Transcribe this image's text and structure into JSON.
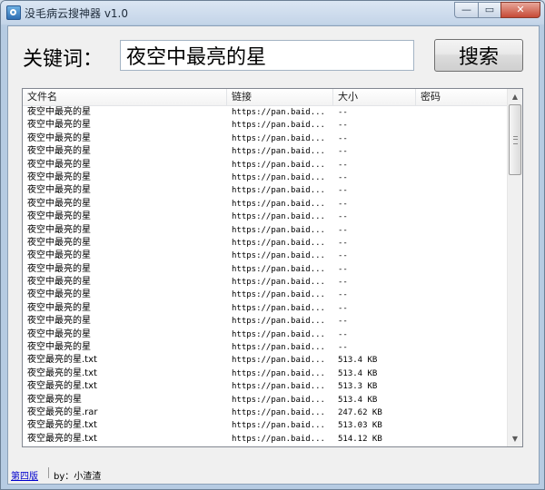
{
  "window": {
    "title": "没毛病云搜神器 v1.0",
    "minimize_glyph": "—",
    "maximize_glyph": "▭",
    "close_glyph": "✕"
  },
  "search": {
    "label": "关键词：",
    "value": "夜空中最亮的星",
    "button_label": "搜索"
  },
  "list": {
    "columns": [
      "文件名",
      "链接",
      "大小",
      "密码"
    ],
    "rows": [
      [
        "夜空中最亮的星",
        "https://pan.baid...",
        "--",
        ""
      ],
      [
        "夜空中最亮的星",
        "https://pan.baid...",
        "--",
        ""
      ],
      [
        "夜空中最亮的星",
        "https://pan.baid...",
        "--",
        ""
      ],
      [
        "夜空中最亮的星",
        "https://pan.baid...",
        "--",
        ""
      ],
      [
        "夜空中最亮的星",
        "https://pan.baid...",
        "--",
        ""
      ],
      [
        "夜空中最亮的星",
        "https://pan.baid...",
        "--",
        ""
      ],
      [
        "夜空中最亮的星",
        "https://pan.baid...",
        "--",
        ""
      ],
      [
        "夜空中最亮的星",
        "https://pan.baid...",
        "--",
        ""
      ],
      [
        "夜空中最亮的星",
        "https://pan.baid...",
        "--",
        ""
      ],
      [
        "夜空中最亮的星",
        "https://pan.baid...",
        "--",
        ""
      ],
      [
        "夜空中最亮的星",
        "https://pan.baid...",
        "--",
        ""
      ],
      [
        "夜空中最亮的星",
        "https://pan.baid...",
        "--",
        ""
      ],
      [
        "夜空中最亮的星",
        "https://pan.baid...",
        "--",
        ""
      ],
      [
        "夜空中最亮的星",
        "https://pan.baid...",
        "--",
        ""
      ],
      [
        "夜空中最亮的星",
        "https://pan.baid...",
        "--",
        ""
      ],
      [
        "夜空中最亮的星",
        "https://pan.baid...",
        "--",
        ""
      ],
      [
        "夜空中最亮的星",
        "https://pan.baid...",
        "--",
        ""
      ],
      [
        "夜空中最亮的星",
        "https://pan.baid...",
        "--",
        ""
      ],
      [
        "夜空中最亮的星",
        "https://pan.baid...",
        "--",
        ""
      ],
      [
        "夜空最亮的星.txt",
        "https://pan.baid...",
        "513.4 KB",
        ""
      ],
      [
        "夜空最亮的星.txt",
        "https://pan.baid...",
        "513.4 KB",
        ""
      ],
      [
        "夜空最亮的星.txt",
        "https://pan.baid...",
        "513.3 KB",
        ""
      ],
      [
        "夜空最亮的星",
        "https://pan.baid...",
        "513.4 KB",
        ""
      ],
      [
        "夜空最亮的星.rar",
        "https://pan.baid...",
        "247.62 KB",
        ""
      ],
      [
        "夜空最亮的星.txt",
        "https://pan.baid...",
        "513.03 KB",
        ""
      ],
      [
        "夜空最亮的星.txt",
        "https://pan.baid...",
        "514.12 KB",
        ""
      ]
    ],
    "scroll_up_glyph": "▲",
    "scroll_down_glyph": "▼"
  },
  "footer": {
    "link_label": "第四版",
    "by_text": "by：小渣渣"
  }
}
